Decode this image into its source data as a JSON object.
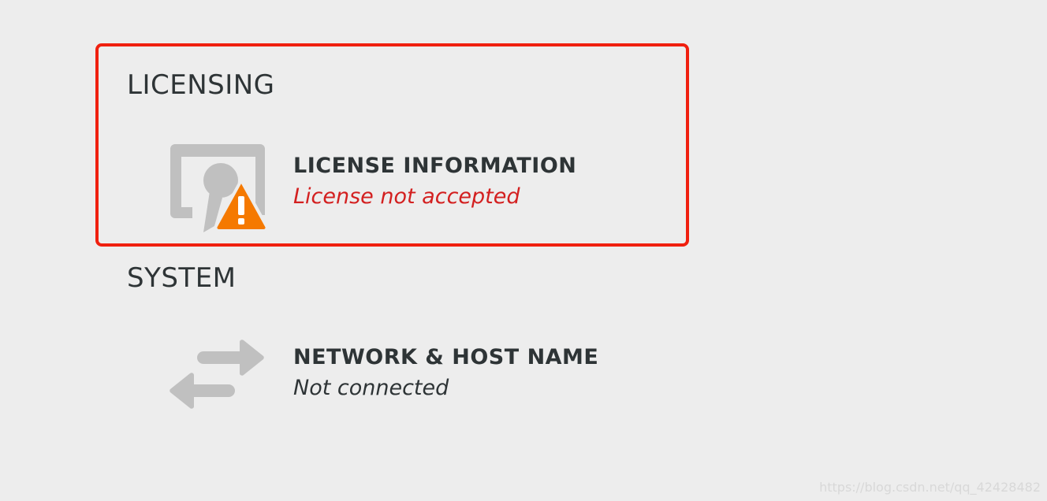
{
  "sections": {
    "licensing": {
      "title": "LICENSING",
      "spoke": {
        "title": "LICENSE INFORMATION",
        "status": "License not accepted",
        "icon": "license-warning-icon"
      }
    },
    "system": {
      "title": "SYSTEM",
      "spoke": {
        "title": "NETWORK & HOST NAME",
        "status": "Not connected",
        "icon": "network-arrows-icon"
      }
    }
  },
  "colors": {
    "background": "#ededed",
    "highlight_border": "#f0200f",
    "error_text": "#d32020",
    "warning_badge": "#f57900",
    "icon_gray": "#c0c0c0"
  },
  "watermark": "https://blog.csdn.net/qq_42428482"
}
